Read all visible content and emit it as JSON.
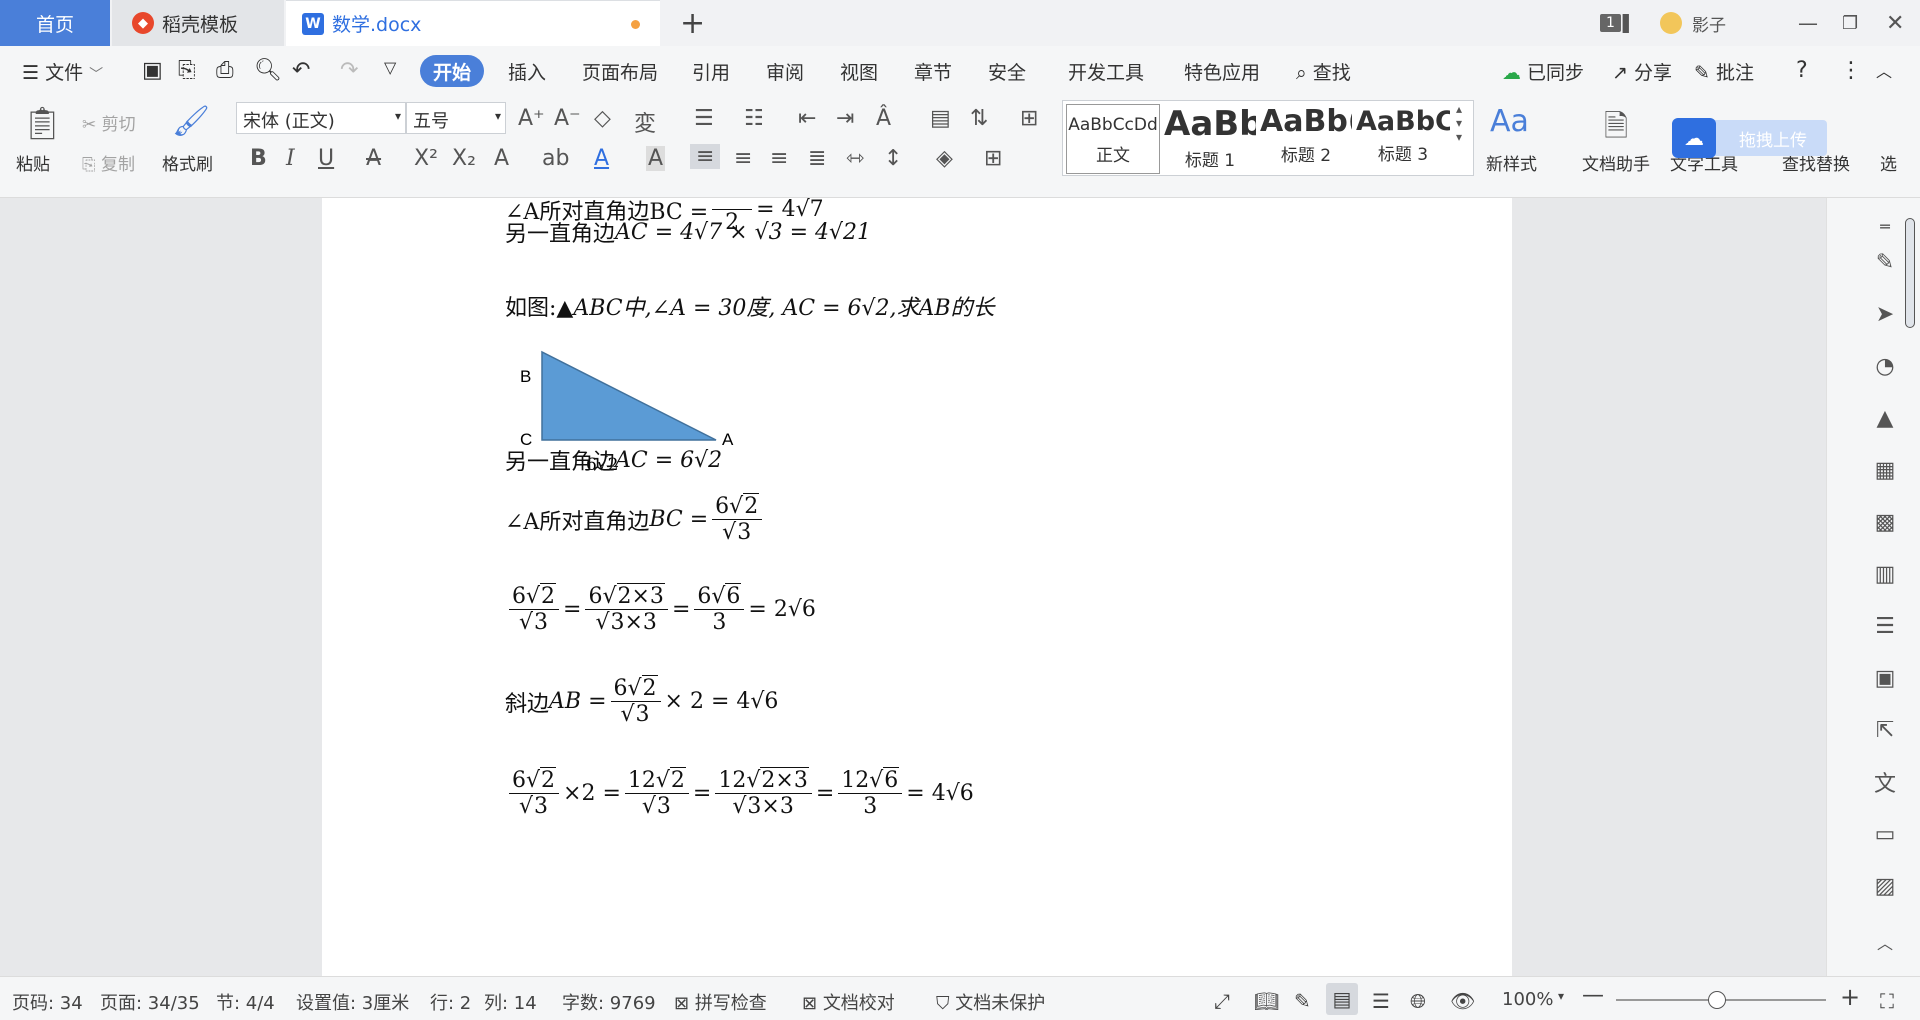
{
  "tabs": {
    "home": "首页",
    "templates": "稻壳模板",
    "document": "数学.docx",
    "doc_icon": "W",
    "new_tab": "+"
  },
  "titlebar": {
    "window_count": "1",
    "user": "影子"
  },
  "menu": {
    "file": "文件",
    "items": [
      "开始",
      "插入",
      "页面布局",
      "引用",
      "审阅",
      "视图",
      "章节",
      "安全",
      "开发工具",
      "特色应用"
    ],
    "search": "查找",
    "synced": "已同步",
    "share": "分享",
    "comment": "批注"
  },
  "ribbon": {
    "paste": "粘贴",
    "cut": "剪切",
    "copy": "复制",
    "format_painter": "格式刷",
    "font_name": "宋体 (正文)",
    "font_size": "五号",
    "styles": [
      {
        "sample": "AaBbCcDd",
        "label": "正文"
      },
      {
        "sample": "AaBb",
        "label": "标题 1"
      },
      {
        "sample": "AaBb(",
        "label": "标题 2"
      },
      {
        "sample": "AaBbC",
        "label": "标题 3"
      }
    ],
    "new_style": "新样式",
    "doc_assistant": "文档助手",
    "text_tools": "文字工具",
    "find_replace": "查找替换",
    "select": "选",
    "upload": "拖拽上传"
  },
  "document": {
    "top_partial": "∠A所对直角边BC = ",
    "line1_prefix": "另一直角边",
    "line1_math": "AC = 4√7 × √3 = 4√21",
    "problem_prefix": "如图:",
    "problem_math": "▲ABC中,∠A = 30度, AC = 6√2,求AB的长",
    "triangle_labels": {
      "b": "B",
      "c": "C",
      "a": "A",
      "base": "6√2"
    },
    "line2_prefix": "另一直角边",
    "line2_math": "AC = 6√2",
    "line3_prefix": "∠A所对直角边",
    "line3_var": "BC =",
    "hyp_prefix": "斜边",
    "hyp_var": "AB =",
    "times2": "× 2 = 4√6",
    "eq_2root6": "= 2√6"
  },
  "status": {
    "page_code": "页码: 34",
    "pages": "页面: 34/35",
    "section": "节: 4/4",
    "setting": "设置值: 3厘米",
    "row": "行: 2",
    "col": "列: 14",
    "word_count": "字数: 9769",
    "spell_check": "拼写检查",
    "doc_proof": "文档校对",
    "doc_unprotected": "文档未保护",
    "zoom": "100%"
  },
  "colors": {
    "accent": "#4a7fd9",
    "triangle_fill": "#5b9bd5",
    "triangle_stroke": "#41719c"
  }
}
